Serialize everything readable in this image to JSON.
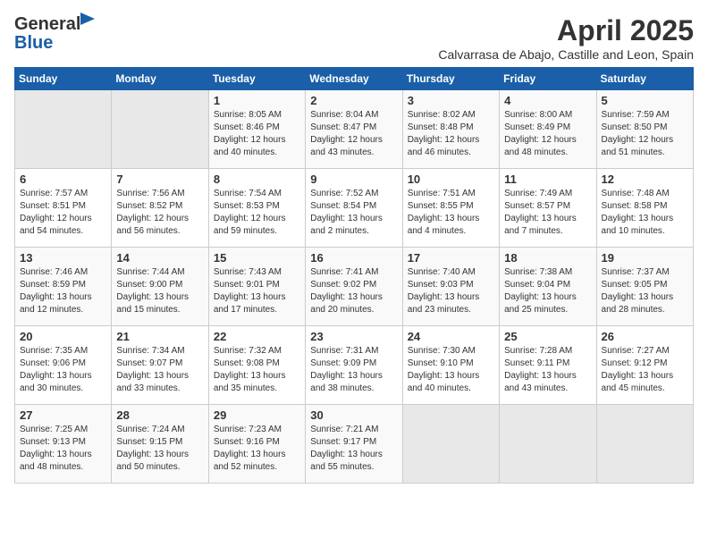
{
  "header": {
    "logo_general": "General",
    "logo_blue": "Blue",
    "title": "April 2025",
    "subtitle": "Calvarrasa de Abajo, Castille and Leon, Spain"
  },
  "weekdays": [
    "Sunday",
    "Monday",
    "Tuesday",
    "Wednesday",
    "Thursday",
    "Friday",
    "Saturday"
  ],
  "weeks": [
    [
      {
        "day": "",
        "content": ""
      },
      {
        "day": "",
        "content": ""
      },
      {
        "day": "1",
        "content": "Sunrise: 8:05 AM\nSunset: 8:46 PM\nDaylight: 12 hours and 40 minutes."
      },
      {
        "day": "2",
        "content": "Sunrise: 8:04 AM\nSunset: 8:47 PM\nDaylight: 12 hours and 43 minutes."
      },
      {
        "day": "3",
        "content": "Sunrise: 8:02 AM\nSunset: 8:48 PM\nDaylight: 12 hours and 46 minutes."
      },
      {
        "day": "4",
        "content": "Sunrise: 8:00 AM\nSunset: 8:49 PM\nDaylight: 12 hours and 48 minutes."
      },
      {
        "day": "5",
        "content": "Sunrise: 7:59 AM\nSunset: 8:50 PM\nDaylight: 12 hours and 51 minutes."
      }
    ],
    [
      {
        "day": "6",
        "content": "Sunrise: 7:57 AM\nSunset: 8:51 PM\nDaylight: 12 hours and 54 minutes."
      },
      {
        "day": "7",
        "content": "Sunrise: 7:56 AM\nSunset: 8:52 PM\nDaylight: 12 hours and 56 minutes."
      },
      {
        "day": "8",
        "content": "Sunrise: 7:54 AM\nSunset: 8:53 PM\nDaylight: 12 hours and 59 minutes."
      },
      {
        "day": "9",
        "content": "Sunrise: 7:52 AM\nSunset: 8:54 PM\nDaylight: 13 hours and 2 minutes."
      },
      {
        "day": "10",
        "content": "Sunrise: 7:51 AM\nSunset: 8:55 PM\nDaylight: 13 hours and 4 minutes."
      },
      {
        "day": "11",
        "content": "Sunrise: 7:49 AM\nSunset: 8:57 PM\nDaylight: 13 hours and 7 minutes."
      },
      {
        "day": "12",
        "content": "Sunrise: 7:48 AM\nSunset: 8:58 PM\nDaylight: 13 hours and 10 minutes."
      }
    ],
    [
      {
        "day": "13",
        "content": "Sunrise: 7:46 AM\nSunset: 8:59 PM\nDaylight: 13 hours and 12 minutes."
      },
      {
        "day": "14",
        "content": "Sunrise: 7:44 AM\nSunset: 9:00 PM\nDaylight: 13 hours and 15 minutes."
      },
      {
        "day": "15",
        "content": "Sunrise: 7:43 AM\nSunset: 9:01 PM\nDaylight: 13 hours and 17 minutes."
      },
      {
        "day": "16",
        "content": "Sunrise: 7:41 AM\nSunset: 9:02 PM\nDaylight: 13 hours and 20 minutes."
      },
      {
        "day": "17",
        "content": "Sunrise: 7:40 AM\nSunset: 9:03 PM\nDaylight: 13 hours and 23 minutes."
      },
      {
        "day": "18",
        "content": "Sunrise: 7:38 AM\nSunset: 9:04 PM\nDaylight: 13 hours and 25 minutes."
      },
      {
        "day": "19",
        "content": "Sunrise: 7:37 AM\nSunset: 9:05 PM\nDaylight: 13 hours and 28 minutes."
      }
    ],
    [
      {
        "day": "20",
        "content": "Sunrise: 7:35 AM\nSunset: 9:06 PM\nDaylight: 13 hours and 30 minutes."
      },
      {
        "day": "21",
        "content": "Sunrise: 7:34 AM\nSunset: 9:07 PM\nDaylight: 13 hours and 33 minutes."
      },
      {
        "day": "22",
        "content": "Sunrise: 7:32 AM\nSunset: 9:08 PM\nDaylight: 13 hours and 35 minutes."
      },
      {
        "day": "23",
        "content": "Sunrise: 7:31 AM\nSunset: 9:09 PM\nDaylight: 13 hours and 38 minutes."
      },
      {
        "day": "24",
        "content": "Sunrise: 7:30 AM\nSunset: 9:10 PM\nDaylight: 13 hours and 40 minutes."
      },
      {
        "day": "25",
        "content": "Sunrise: 7:28 AM\nSunset: 9:11 PM\nDaylight: 13 hours and 43 minutes."
      },
      {
        "day": "26",
        "content": "Sunrise: 7:27 AM\nSunset: 9:12 PM\nDaylight: 13 hours and 45 minutes."
      }
    ],
    [
      {
        "day": "27",
        "content": "Sunrise: 7:25 AM\nSunset: 9:13 PM\nDaylight: 13 hours and 48 minutes."
      },
      {
        "day": "28",
        "content": "Sunrise: 7:24 AM\nSunset: 9:15 PM\nDaylight: 13 hours and 50 minutes."
      },
      {
        "day": "29",
        "content": "Sunrise: 7:23 AM\nSunset: 9:16 PM\nDaylight: 13 hours and 52 minutes."
      },
      {
        "day": "30",
        "content": "Sunrise: 7:21 AM\nSunset: 9:17 PM\nDaylight: 13 hours and 55 minutes."
      },
      {
        "day": "",
        "content": ""
      },
      {
        "day": "",
        "content": ""
      },
      {
        "day": "",
        "content": ""
      }
    ]
  ]
}
